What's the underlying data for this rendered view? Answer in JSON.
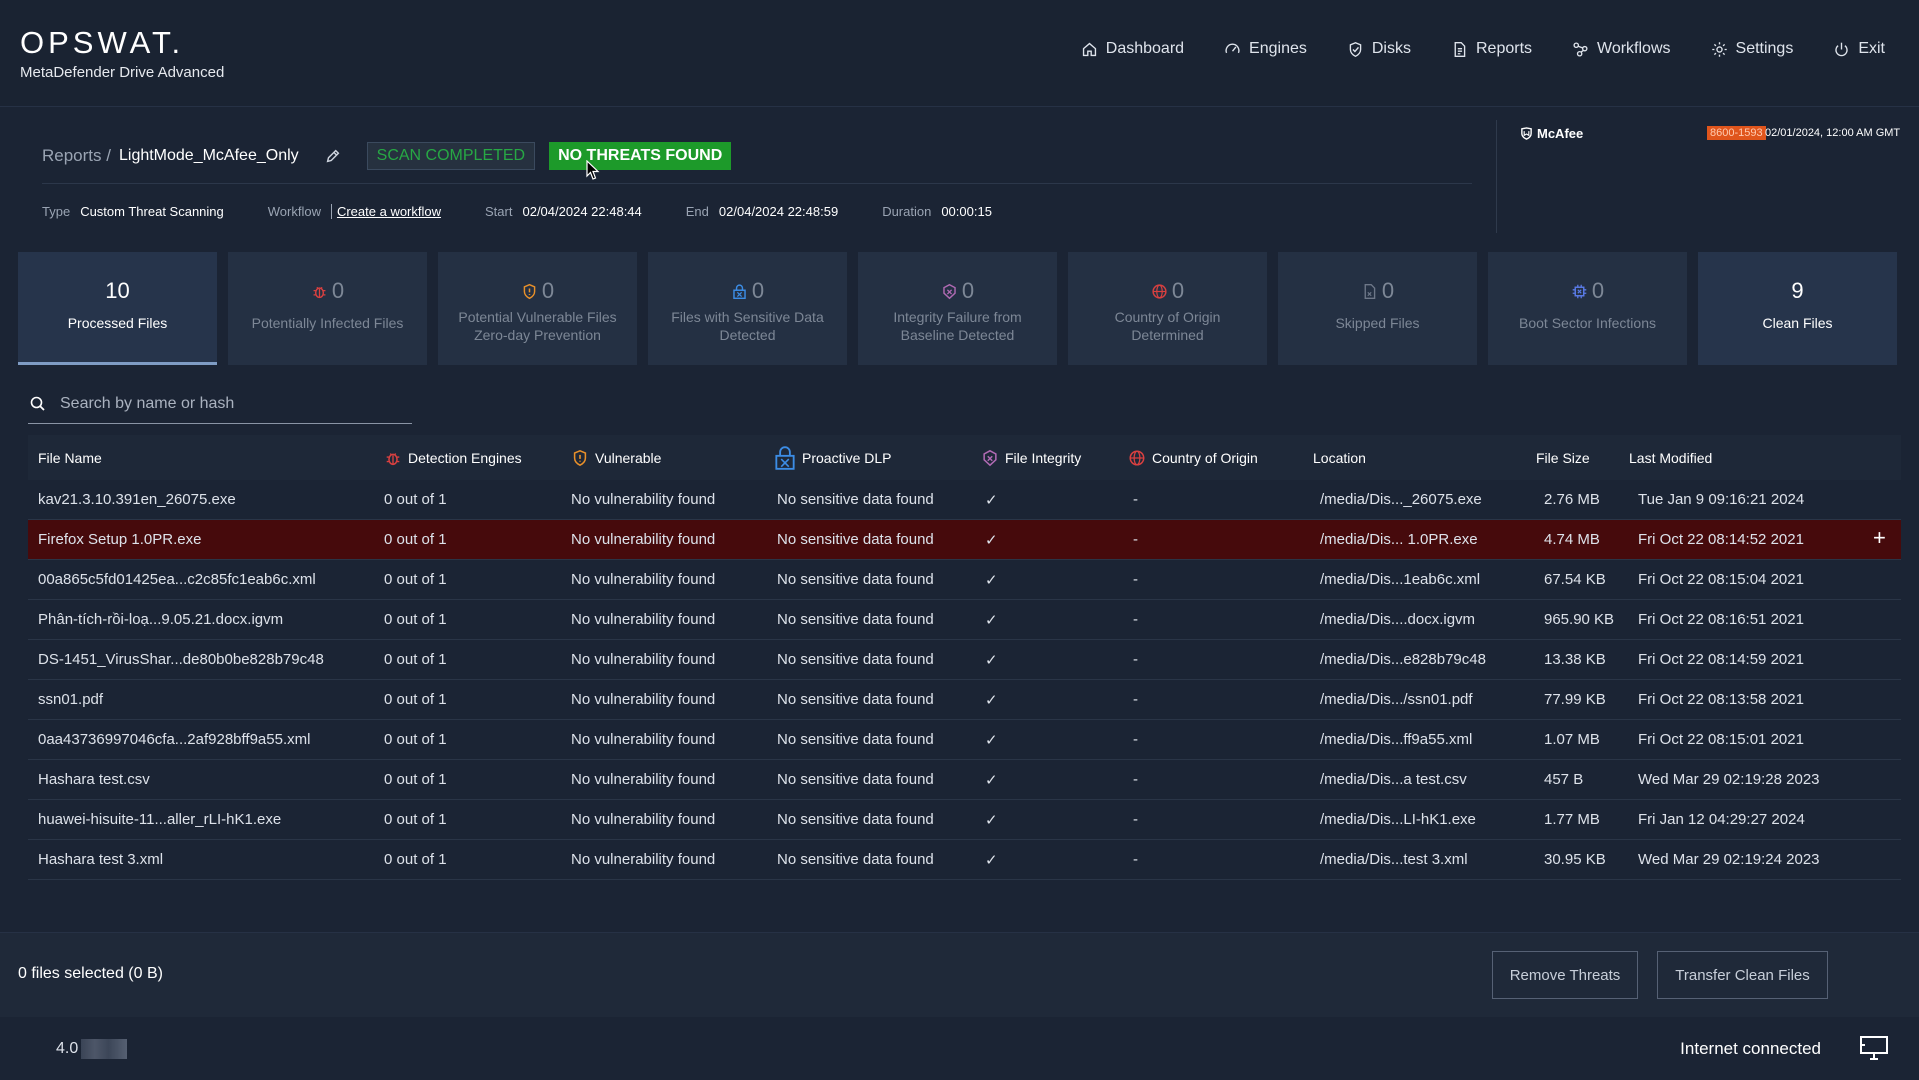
{
  "brand": {
    "logo": "OPSWAT.",
    "product": "MetaDefender Drive Advanced"
  },
  "nav": [
    {
      "label": "Dashboard",
      "icon": "home-icon"
    },
    {
      "label": "Engines",
      "icon": "gauge-icon"
    },
    {
      "label": "Disks",
      "icon": "shield-check-icon"
    },
    {
      "label": "Reports",
      "icon": "document-icon"
    },
    {
      "label": "Workflows",
      "icon": "workflow-icon"
    },
    {
      "label": "Settings",
      "icon": "gear-icon"
    },
    {
      "label": "Exit",
      "icon": "power-icon"
    }
  ],
  "report": {
    "crumb": "Reports /",
    "name": "LightMode_McAfee_Only",
    "status": "SCAN COMPLETED",
    "verdict": "NO THREATS FOUND",
    "type_label": "Type",
    "type_value": "Custom Threat Scanning",
    "workflow_label": "Workflow",
    "workflow_link": "Create a workflow",
    "start_label": "Start",
    "start_value": "02/04/2024 22:48:44",
    "end_label": "End",
    "end_value": "02/04/2024 22:48:59",
    "duration_label": "Duration",
    "duration_value": "00:00:15"
  },
  "engine": {
    "name": "McAfee",
    "version": "8600-1593",
    "date": "02/01/2024, 12:00 AM GMT"
  },
  "cards": [
    {
      "num": "10",
      "label": "Processed Files",
      "icon": ""
    },
    {
      "num": "0",
      "label": "Potentially Infected Files",
      "icon": "bug-icon"
    },
    {
      "num": "0",
      "label": "Potential Vulnerable Files Zero-day Prevention",
      "icon": "shield-alert-icon"
    },
    {
      "num": "0",
      "label": "Files with Sensitive Data Detected",
      "icon": "lock-icon"
    },
    {
      "num": "0",
      "label": "Integrity Failure from Baseline Detected",
      "icon": "integrity-icon"
    },
    {
      "num": "0",
      "label": "Country of Origin Determined",
      "icon": "globe-icon"
    },
    {
      "num": "0",
      "label": "Skipped Files",
      "icon": "file-icon"
    },
    {
      "num": "0",
      "label": "Boot Sector Infections",
      "icon": "chip-icon"
    },
    {
      "num": "9",
      "label": "Clean Files",
      "icon": ""
    }
  ],
  "search": {
    "placeholder": "Search by name or hash"
  },
  "table": {
    "headers": [
      "File Name",
      "Detection Engines",
      "Vulnerable",
      "Proactive DLP",
      "File Integrity",
      "Country of Origin",
      "Location",
      "File Size",
      "Last Modified"
    ],
    "rows": [
      [
        "kav21.3.10.391en_26075.exe",
        "0 out of 1",
        "No vulnerability found",
        "No sensitive data found",
        "✓",
        "-",
        "/media/Dis..._26075.exe",
        "2.76 MB",
        "Tue Jan 9 09:16:21 2024"
      ],
      [
        "Firefox Setup 1.0PR.exe",
        "0 out of 1",
        "No vulnerability found",
        "No sensitive data found",
        "✓",
        "-",
        "/media/Dis... 1.0PR.exe",
        "4.74 MB",
        "Fri Oct 22 08:14:52 2021"
      ],
      [
        "00a865c5fd01425ea...c2c85fc1eab6c.xml",
        "0 out of 1",
        "No vulnerability found",
        "No sensitive data found",
        "✓",
        "-",
        "/media/Dis...1eab6c.xml",
        "67.54 KB",
        "Fri Oct 22 08:15:04 2021"
      ],
      [
        "Phân-tích-rồi-loạ...9.05.21.docx.igvm",
        "0 out of 1",
        "No vulnerability found",
        "No sensitive data found",
        "✓",
        "-",
        "/media/Dis....docx.igvm",
        "965.90 KB",
        "Fri Oct 22 08:16:51 2021"
      ],
      [
        "DS-1451_VirusShar...de80b0be828b79c48",
        "0 out of 1",
        "No vulnerability found",
        "No sensitive data found",
        "✓",
        "-",
        "/media/Dis...e828b79c48",
        "13.38 KB",
        "Fri Oct 22 08:14:59 2021"
      ],
      [
        "ssn01.pdf",
        "0 out of 1",
        "No vulnerability found",
        "No sensitive data found",
        "✓",
        "-",
        "/media/Dis.../ssn01.pdf",
        "77.99 KB",
        "Fri Oct 22 08:13:58 2021"
      ],
      [
        "0aa43736997046cfa...2af928bff9a55.xml",
        "0 out of 1",
        "No vulnerability found",
        "No sensitive data found",
        "✓",
        "-",
        "/media/Dis...ff9a55.xml",
        "1.07 MB",
        "Fri Oct 22 08:15:01 2021"
      ],
      [
        "Hashara test.csv",
        "0 out of 1",
        "No vulnerability found",
        "No sensitive data found",
        "✓",
        "-",
        "/media/Dis...a test.csv",
        "457 B",
        "Wed Mar 29 02:19:28 2023"
      ],
      [
        "huawei-hisuite-11...aller_rLI-hK1.exe",
        "0 out of 1",
        "No vulnerability found",
        "No sensitive data found",
        "✓",
        "-",
        "/media/Dis...LI-hK1.exe",
        "1.77 MB",
        "Fri Jan 12 04:29:27 2024"
      ],
      [
        "Hashara test 3.xml",
        "0 out of 1",
        "No vulnerability found",
        "No sensitive data found",
        "✓",
        "-",
        "/media/Dis...test 3.xml",
        "30.95 KB",
        "Wed Mar 29 02:19:24 2023"
      ]
    ],
    "selected_row_action": "+"
  },
  "footer": {
    "selection": "0 files selected (0 B)",
    "remove_btn": "Remove Threats",
    "transfer_btn": "Transfer Clean Files",
    "version": "4.0",
    "network": "Internet connected"
  },
  "colors": {
    "accent_green": "#1d9a2a",
    "selected_row": "#460a0c",
    "threat_red": "#d94040",
    "vuln_orange": "#e8902a",
    "dlp_blue": "#3c8de6"
  }
}
